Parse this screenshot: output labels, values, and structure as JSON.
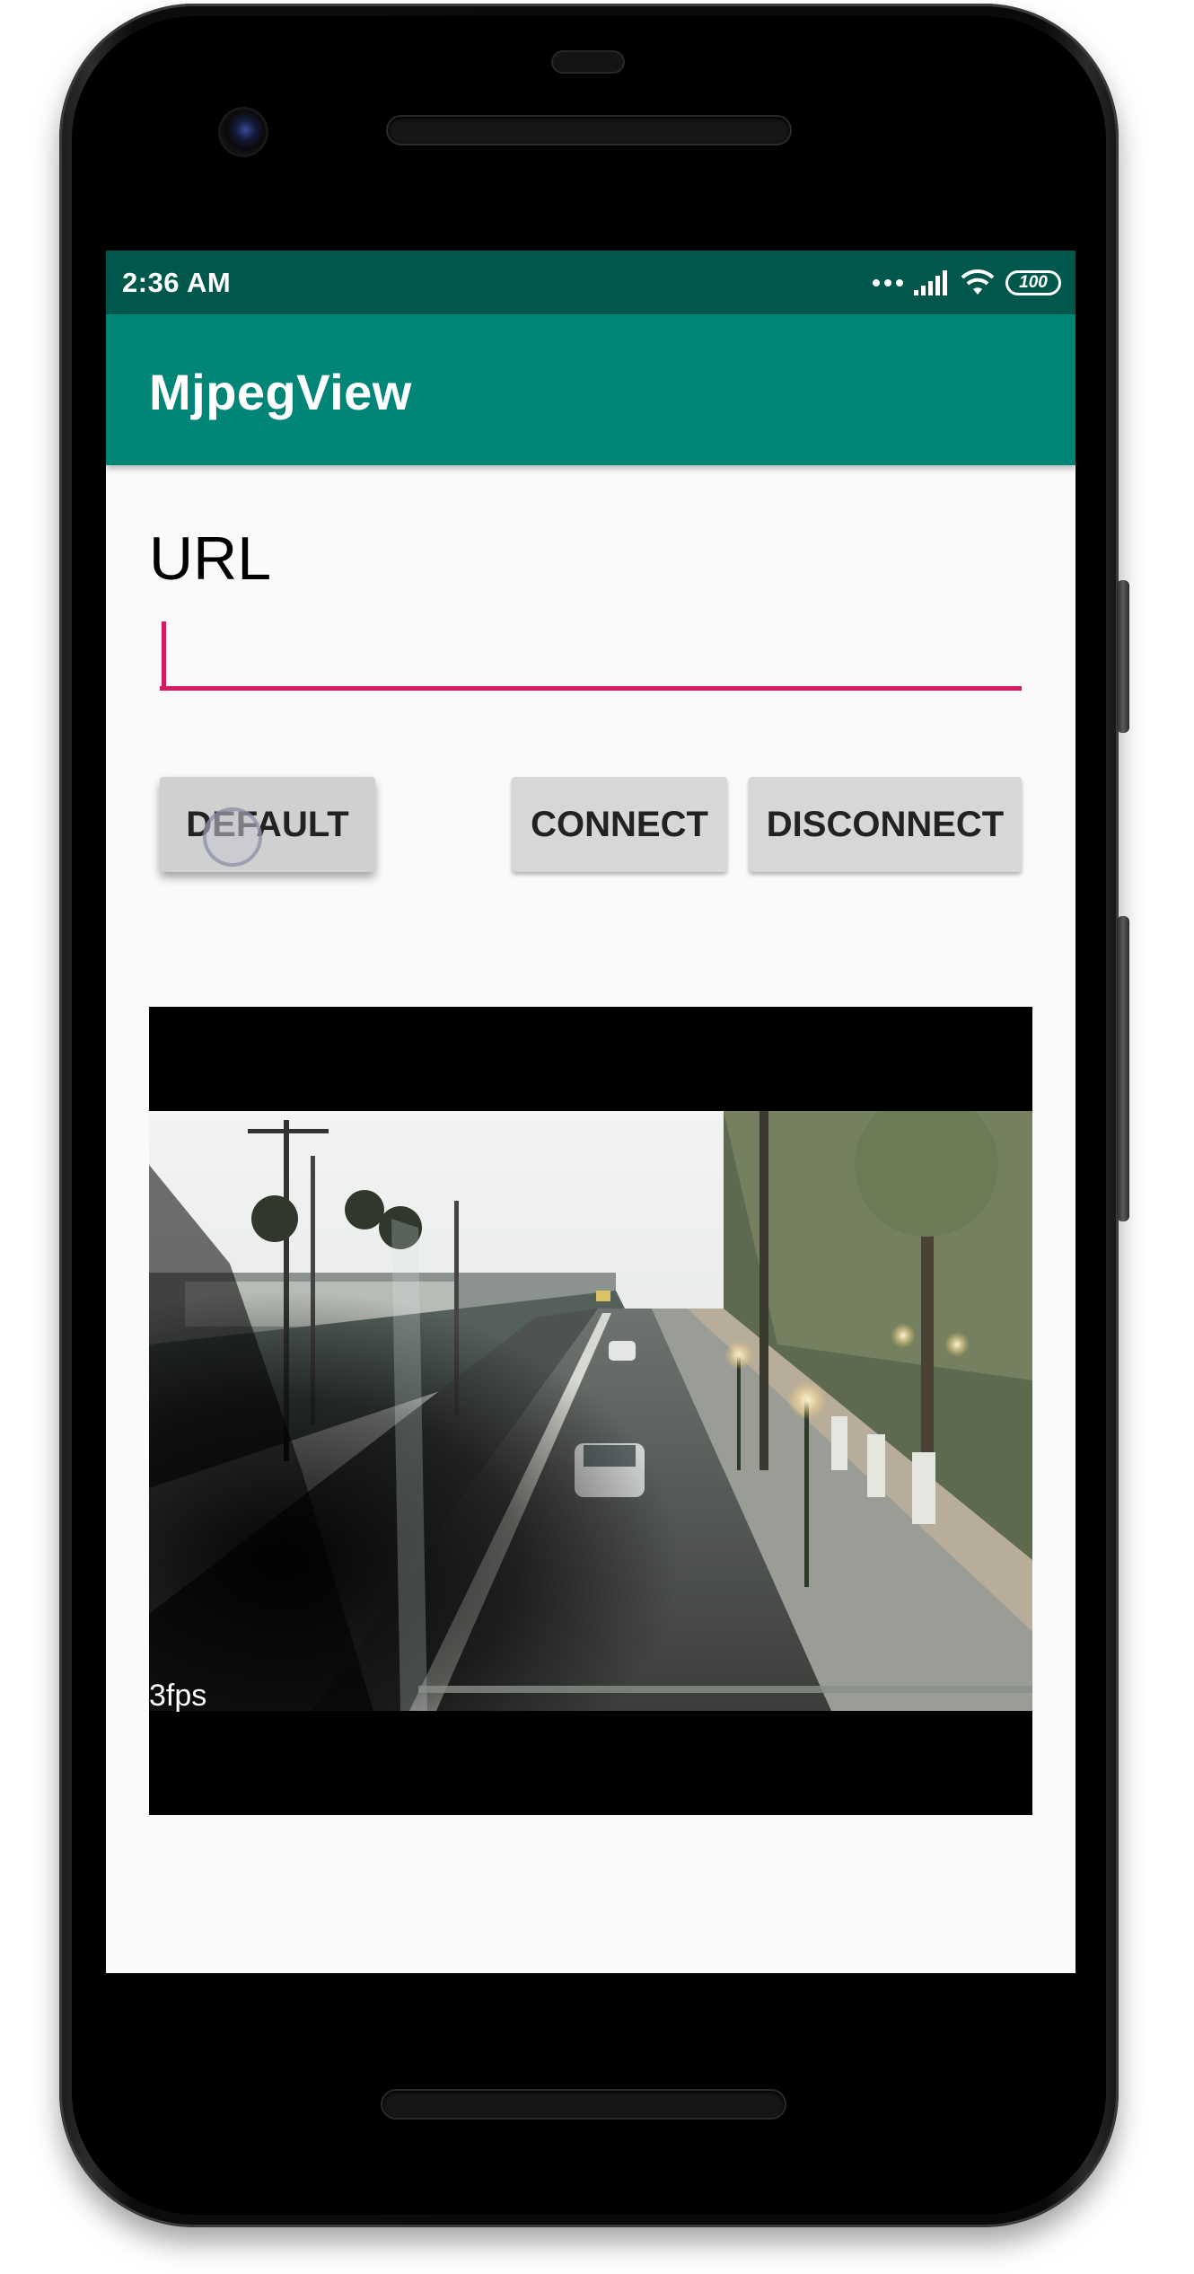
{
  "status_bar": {
    "time": "2:36 AM",
    "battery": "100"
  },
  "app_bar": {
    "title": "MjpegView"
  },
  "form": {
    "url_label": "URL",
    "url_value": "",
    "url_placeholder": ""
  },
  "buttons": {
    "default_label": "DEFAULT",
    "connect_label": "CONNECT",
    "disconnect_label": "DISCONNECT"
  },
  "stream": {
    "fps_text": "3fps"
  },
  "colors": {
    "status_bar": "#00574b",
    "app_bar": "#008577",
    "accent": "#d81b60",
    "button": "#d6d7d7",
    "background": "#fafafa"
  },
  "icons": [
    "more-dots-icon",
    "cellular-signal-icon",
    "wifi-icon",
    "battery-icon"
  ]
}
